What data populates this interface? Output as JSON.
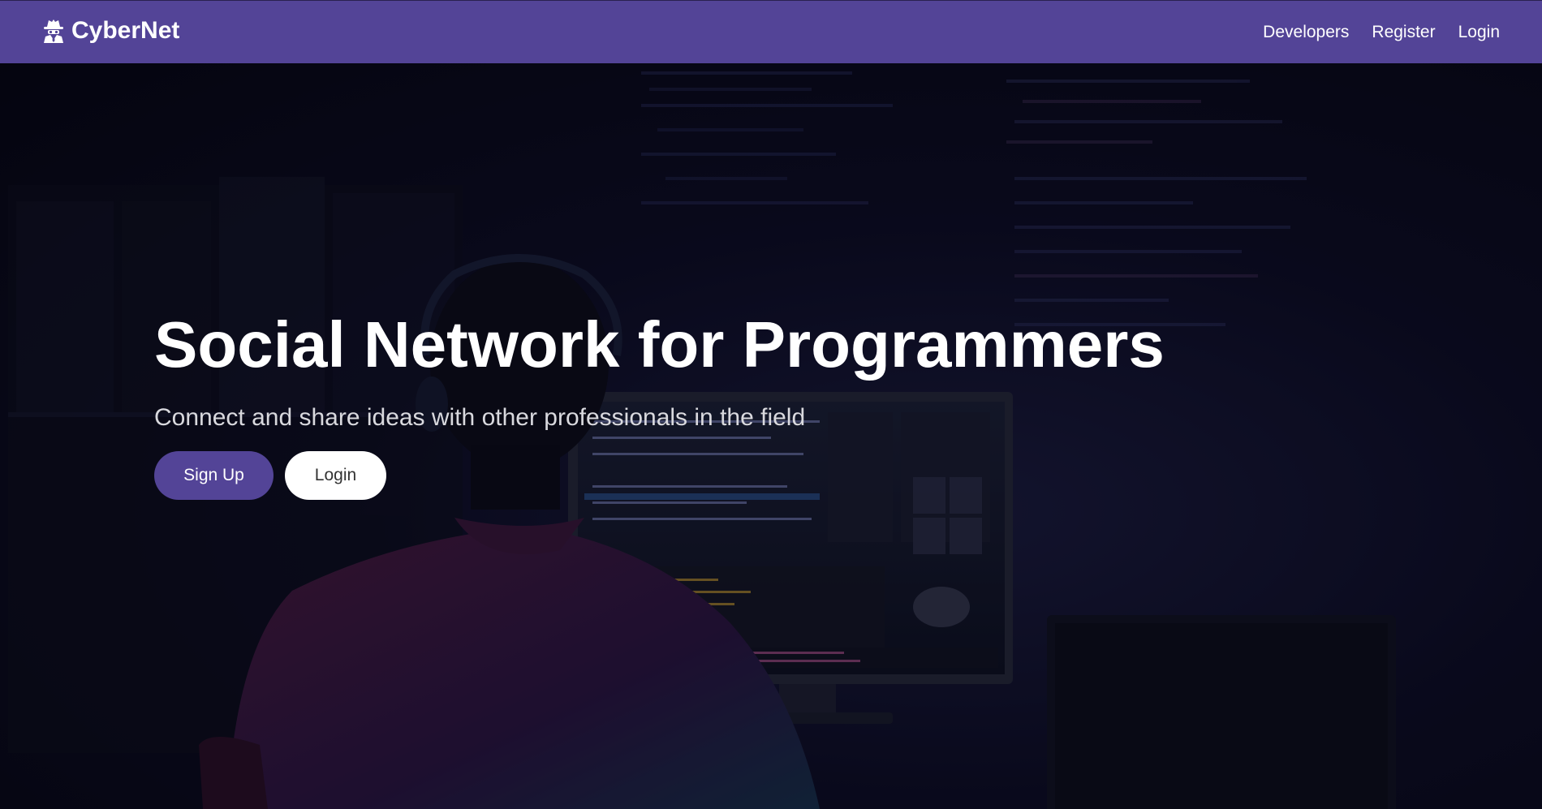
{
  "navbar": {
    "brand": "CyberNet",
    "brand_icon": "user-secret-icon",
    "links": {
      "developers": "Developers",
      "register": "Register",
      "login": "Login"
    },
    "background_color": "#534497"
  },
  "hero": {
    "title": "Social Network for Programmers",
    "subtitle": "Connect and share ideas with other professionals in the field",
    "buttons": {
      "signup": "Sign Up",
      "login": "Login"
    }
  },
  "colors": {
    "primary": "#534497",
    "light": "#ffffff",
    "hero_text": "#ffffff"
  }
}
